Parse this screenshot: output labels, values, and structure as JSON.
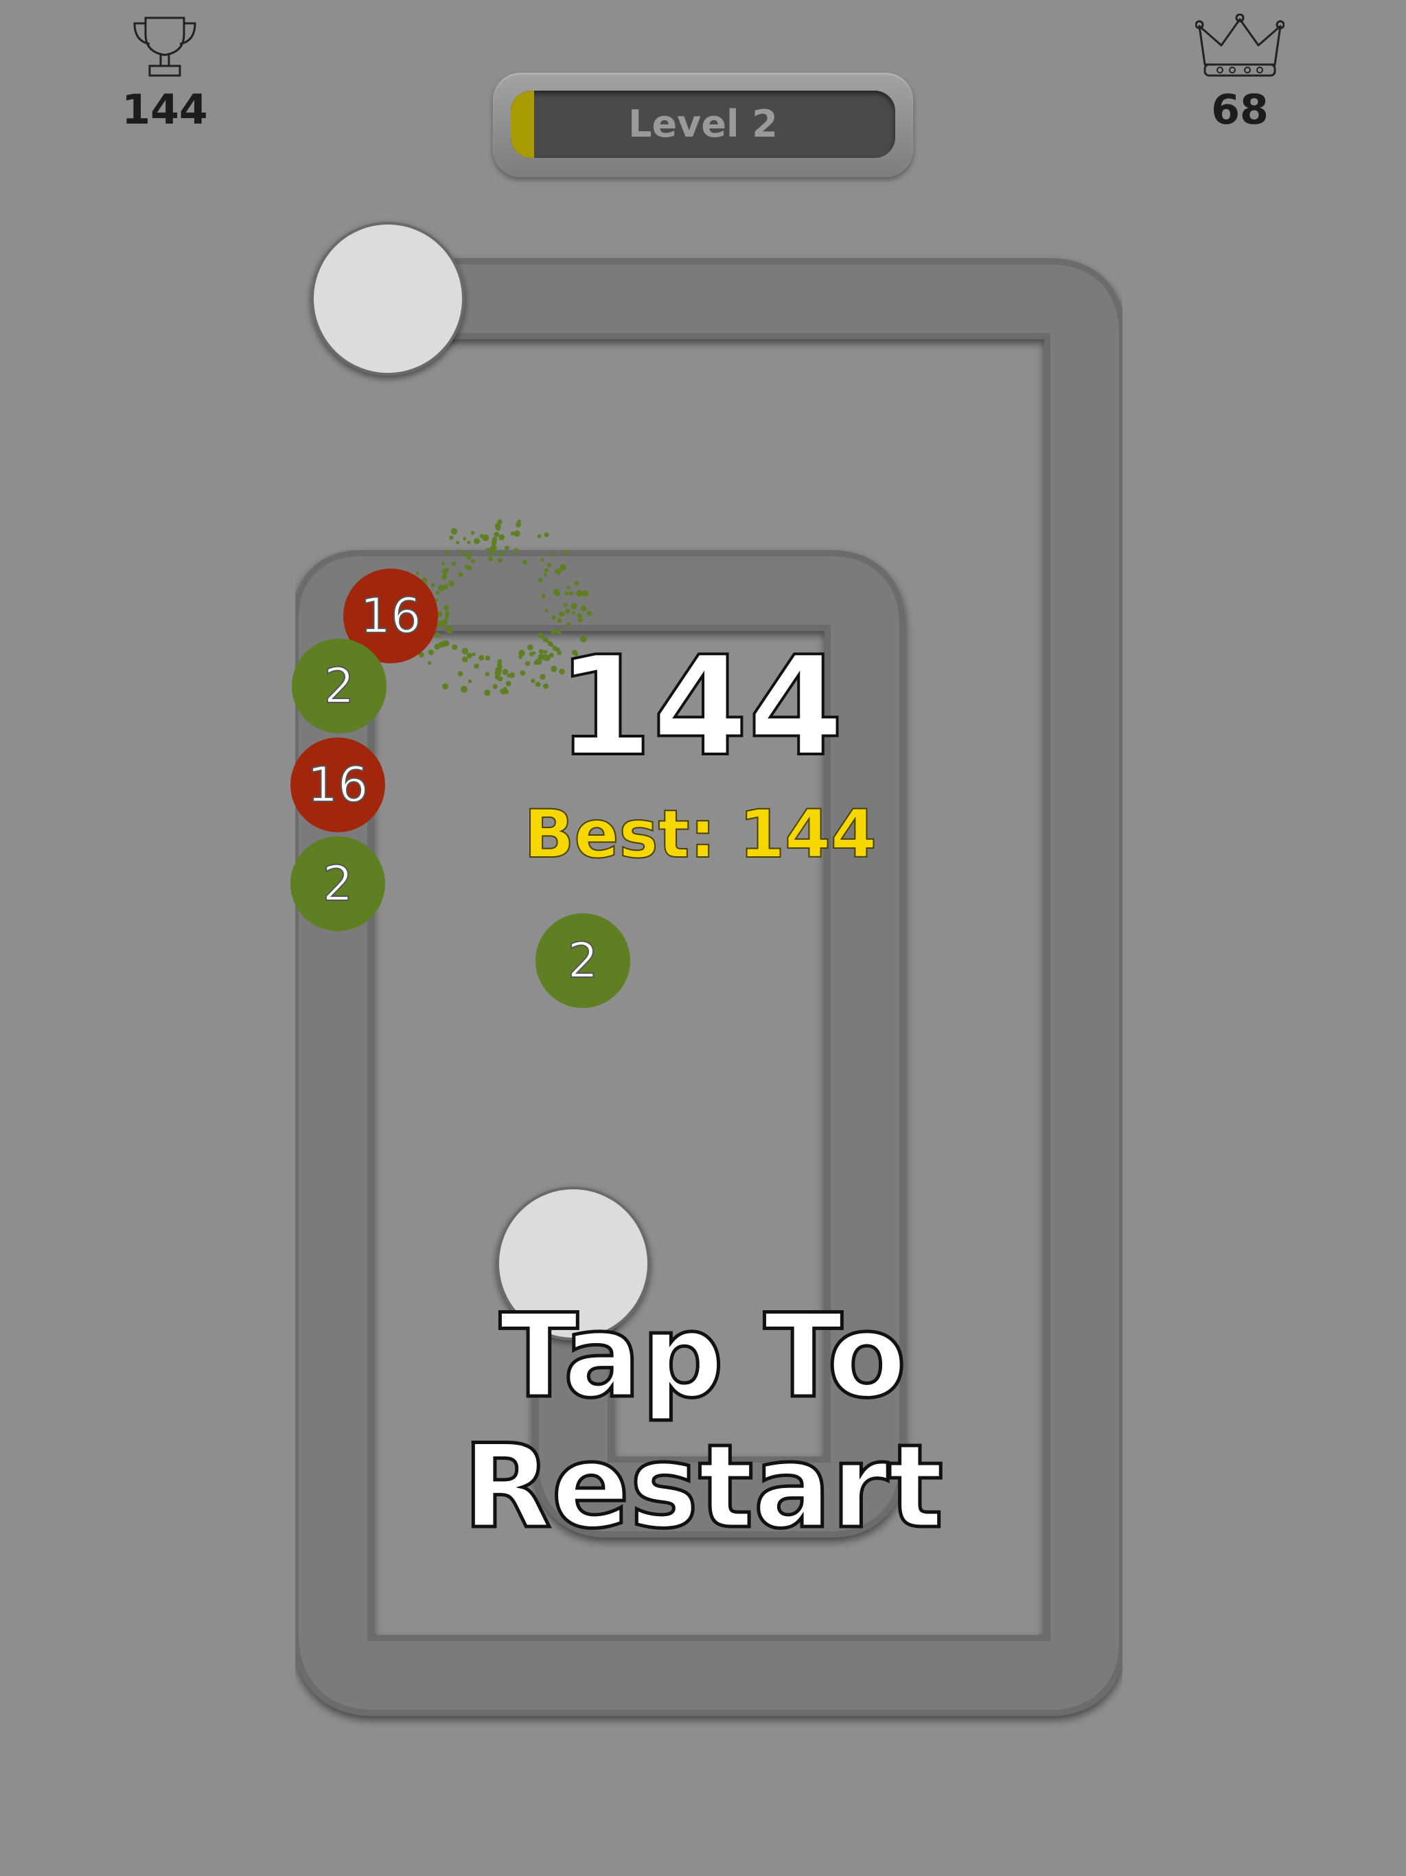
{
  "hud": {
    "score": "144",
    "score_icon": "trophy-icon",
    "crowns": "68",
    "crowns_icon": "crown-icon"
  },
  "level": {
    "label": "Level 2",
    "progress": 0.06,
    "fill_color": "#a89a00"
  },
  "game_over": {
    "score": "144",
    "best": "Best: 144",
    "restart": "Tap To Restart"
  },
  "balls": [
    {
      "value": "16",
      "color": "red"
    },
    {
      "value": "2",
      "color": "green"
    },
    {
      "value": "16",
      "color": "red"
    },
    {
      "value": "2",
      "color": "green"
    },
    {
      "value": "2",
      "color": "green"
    }
  ],
  "colors": {
    "background": "#8e8e8e",
    "track": "#7a7a7a",
    "green_ball": "#5e7f22",
    "red_ball": "#a1260c",
    "best_text": "#f6d700"
  }
}
